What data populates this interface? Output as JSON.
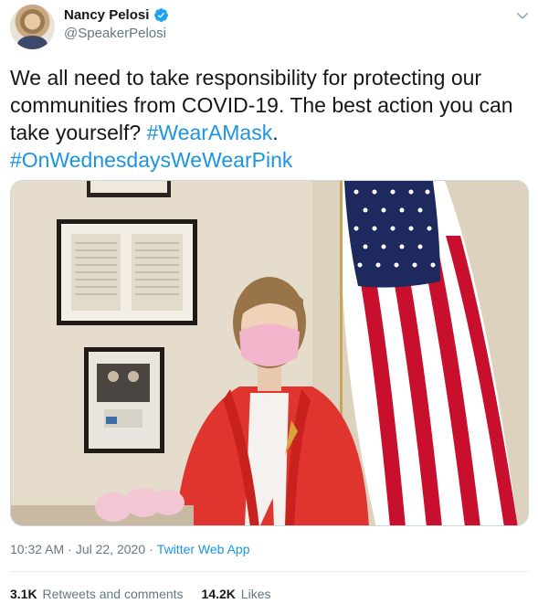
{
  "author": {
    "name": "Nancy Pelosi",
    "handle": "@SpeakerPelosi",
    "verified": true
  },
  "tweet": {
    "text_plain": "We all need to take responsibility for protecting our communities from COVID-19. The best action you can take yourself?",
    "hashtag_1": "#WearAMask",
    "after_hashtag_1": ".",
    "hashtag_2": "#OnWednesdaysWeWearPink"
  },
  "meta": {
    "time": "10:32 AM",
    "separator_1": "·",
    "date": "Jul 22, 2020",
    "separator_2": "·",
    "source": "Twitter Web App"
  },
  "stats": {
    "retweets_count": "3.1K",
    "retweets_label": "Retweets and comments",
    "likes_count": "14.2K",
    "likes_label": "Likes"
  },
  "icons": {
    "verified": "verified-badge-icon",
    "more": "chevron-down-icon"
  },
  "colors": {
    "link": "#1b95e0",
    "verified": "#1da1f2",
    "secondary_text": "#657786"
  }
}
